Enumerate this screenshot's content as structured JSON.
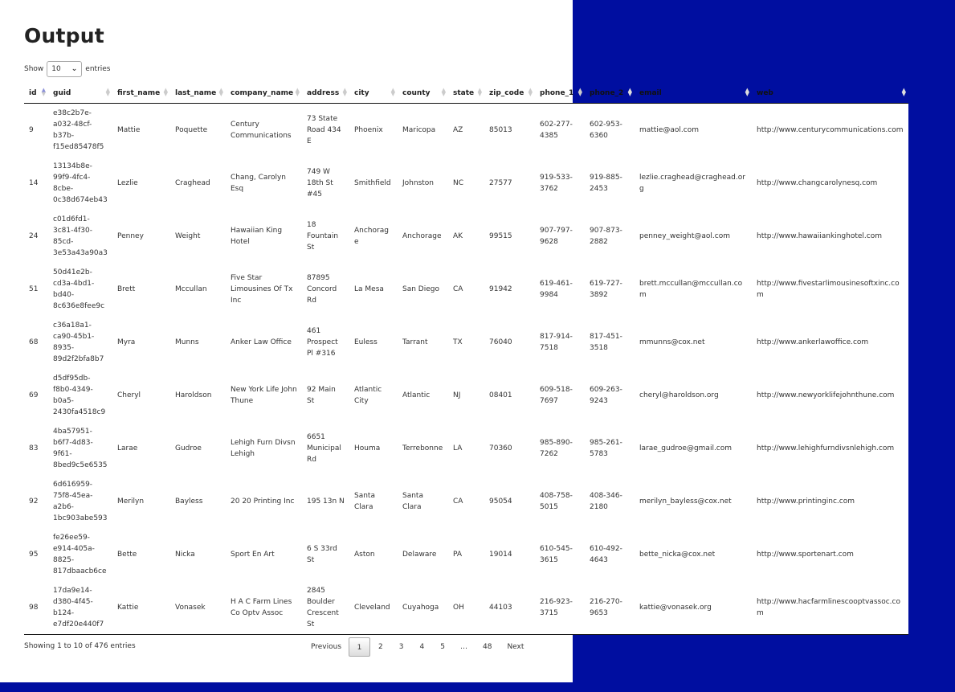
{
  "page": {
    "title": "Output",
    "background_color": "#000ea0"
  },
  "length": {
    "show_label": "Show",
    "value": "10",
    "entries_label": "entries"
  },
  "columns": [
    "id",
    "guid",
    "first_name",
    "last_name",
    "company_name",
    "address",
    "city",
    "county",
    "state",
    "zip_code",
    "phone_1",
    "phone_2",
    "email",
    "web"
  ],
  "sorted_column": "id",
  "rows": [
    [
      "9",
      "e38c2b7e-a032-48cf-b37b-f15ed85478f5",
      "Mattie",
      "Poquette",
      "Century Communications",
      "73 State Road 434 E",
      "Phoenix",
      "Maricopa",
      "AZ",
      "85013",
      "602-277-4385",
      "602-953-6360",
      "mattie@aol.com",
      "http://www.centurycommunications.com"
    ],
    [
      "14",
      "13134b8e-99f9-4fc4-8cbe-0c38d674eb43",
      "Lezlie",
      "Craghead",
      "Chang, Carolyn Esq",
      "749 W 18th St #45",
      "Smithfield",
      "Johnston",
      "NC",
      "27577",
      "919-533-3762",
      "919-885-2453",
      "lezlie.craghead@craghead.org",
      "http://www.changcarolynesq.com"
    ],
    [
      "24",
      "c01d6fd1-3c81-4f30-85cd-3e53a43a90a3",
      "Penney",
      "Weight",
      "Hawaiian King Hotel",
      "18 Fountain St",
      "Anchorage",
      "Anchorage",
      "AK",
      "99515",
      "907-797-9628",
      "907-873-2882",
      "penney_weight@aol.com",
      "http://www.hawaiiankinghotel.com"
    ],
    [
      "51",
      "50d41e2b-cd3a-4bd1-bd40-8c636e8fee9c",
      "Brett",
      "Mccullan",
      "Five Star Limousines Of Tx Inc",
      "87895 Concord Rd",
      "La Mesa",
      "San Diego",
      "CA",
      "91942",
      "619-461-9984",
      "619-727-3892",
      "brett.mccullan@mccullan.com",
      "http://www.fivestarlimousinesoftxinc.com"
    ],
    [
      "68",
      "c36a18a1-ca90-45b1-8935-89d2f2bfa8b7",
      "Myra",
      "Munns",
      "Anker Law Office",
      "461 Prospect Pl #316",
      "Euless",
      "Tarrant",
      "TX",
      "76040",
      "817-914-7518",
      "817-451-3518",
      "mmunns@cox.net",
      "http://www.ankerlawoffice.com"
    ],
    [
      "69",
      "d5df95db-f8b0-4349-b0a5-2430fa4518c9",
      "Cheryl",
      "Haroldson",
      "New York Life John Thune",
      "92 Main St",
      "Atlantic City",
      "Atlantic",
      "NJ",
      "08401",
      "609-518-7697",
      "609-263-9243",
      "cheryl@haroldson.org",
      "http://www.newyorklifejohnthune.com"
    ],
    [
      "83",
      "4ba57951-b6f7-4d83-9f61-8bed9c5e6535",
      "Larae",
      "Gudroe",
      "Lehigh Furn Divsn Lehigh",
      "6651 Municipal Rd",
      "Houma",
      "Terrebonne",
      "LA",
      "70360",
      "985-890-7262",
      "985-261-5783",
      "larae_gudroe@gmail.com",
      "http://www.lehighfurndivsnlehigh.com"
    ],
    [
      "92",
      "6d616959-75f8-45ea-a2b6-1bc903abe593",
      "Merilyn",
      "Bayless",
      "20 20 Printing Inc",
      "195 13n N",
      "Santa Clara",
      "Santa Clara",
      "CA",
      "95054",
      "408-758-5015",
      "408-346-2180",
      "merilyn_bayless@cox.net",
      "http://www.printinginc.com"
    ],
    [
      "95",
      "fe26ee59-e914-405a-8825-817dbaacb6ce",
      "Bette",
      "Nicka",
      "Sport En Art",
      "6 S 33rd St",
      "Aston",
      "Delaware",
      "PA",
      "19014",
      "610-545-3615",
      "610-492-4643",
      "bette_nicka@cox.net",
      "http://www.sportenart.com"
    ],
    [
      "98",
      "17da9e14-d380-4f45-b124-e7df20e440f7",
      "Kattie",
      "Vonasek",
      "H A C Farm Lines Co Optv Assoc",
      "2845 Boulder Crescent St",
      "Cleveland",
      "Cuyahoga",
      "OH",
      "44103",
      "216-923-3715",
      "216-270-9653",
      "kattie@vonasek.org",
      "http://www.hacfarmlinescooptvassoc.com"
    ]
  ],
  "footer": {
    "info": "Showing 1 to 10 of 476 entries",
    "previous": "Previous",
    "pages": [
      "1",
      "2",
      "3",
      "4",
      "5",
      "…",
      "48"
    ],
    "current_page": "1",
    "next": "Next"
  }
}
